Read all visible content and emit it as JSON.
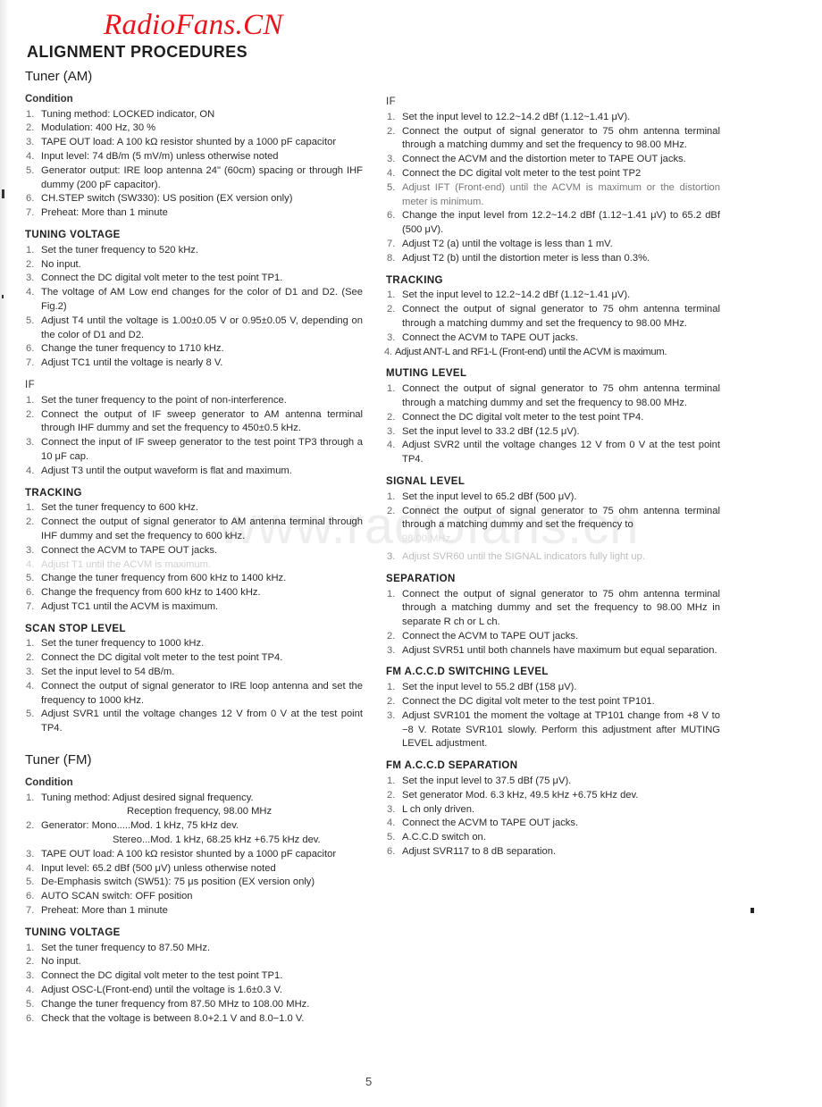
{
  "header": {
    "logo": "RadioFans.CN",
    "title": "ALIGNMENT PROCEDURES",
    "watermark": "www.radiofans.cn",
    "logo_color": "#e8141c"
  },
  "tuner_am": {
    "title": "Tuner (AM)",
    "condition": {
      "title": "Condition",
      "items": [
        "Tuning method: LOCKED indicator, ON",
        "Modulation: 400 Hz, 30 %",
        "TAPE OUT load: A 100 kΩ resistor shunted by a 1000 pF capacitor",
        "Input level: 74 dB/m (5 mV/m) unless otherwise noted",
        "Generator output: IRE loop antenna 24\" (60cm) spacing or through IHF dummy (200 pF capacitor).",
        "CH.STEP switch (SW330): US position (EX version only)",
        "Preheat: More than 1 minute"
      ]
    },
    "tuning_voltage": {
      "title": "TUNING VOLTAGE",
      "items": [
        "Set the tuner frequency to 520 kHz.",
        "No input.",
        "Connect the DC digital volt meter to the test point TP1.",
        "The voltage of AM Low end changes for the color of D1 and D2. (See Fig.2)",
        "Adjust T4 until the voltage is 1.00±0.05 V or 0.95±0.05 V, depending on the color of D1 and D2.",
        "Change the tuner frequency to 1710 kHz.",
        "Adjust TC1 until the voltage is nearly 8 V."
      ]
    },
    "if": {
      "title": "IF",
      "items": [
        "Set the tuner frequency to the point of non-interference.",
        "Connect the output of IF sweep generator to AM antenna terminal through IHF dummy and set the frequency to 450±0.5 kHz.",
        "Connect the input of IF sweep generator to the test point TP3 through a 10 μF cap.",
        "Adjust T3 until the output waveform is flat and maximum."
      ]
    },
    "tracking": {
      "title": "TRACKING",
      "items": [
        "Set the tuner frequency to 600 kHz.",
        "Connect the output of signal generator to AM antenna terminal through IHF dummy and set the frequency to 600 kHz.",
        "Connect the ACVM to TAPE OUT jacks.",
        "Adjust T1 until the ACVM is maximum.",
        "Change the tuner frequency from 600 kHz to 1400 kHz.",
        "Change the frequency from 600 kHz to 1400 kHz.",
        "Adjust TC1 until the ACVM is maximum."
      ]
    },
    "scan_stop_level": {
      "title": "SCAN STOP LEVEL",
      "items": [
        "Set the tuner frequency to 1000 kHz.",
        "Connect the DC digital volt meter to the test point TP4.",
        "Set the input level to 54 dB/m.",
        "Connect the output of signal generator to IRE loop antenna and set the frequency to 1000 kHz.",
        "Adjust SVR1 until the voltage changes 12 V from 0 V at the test point TP4."
      ]
    }
  },
  "tuner_fm": {
    "title": "Tuner (FM)",
    "condition": {
      "title": "Condition",
      "item1_a": "Tuning method: Adjust desired signal frequency.",
      "item1_b": "Reception frequency, 98.00 MHz",
      "item2_a": "Generator: Mono.....Mod. 1 kHz, 75 kHz dev.",
      "item2_b": "Stereo...Mod. 1 kHz, 68.25 kHz +6.75 kHz dev.",
      "items_rest": [
        "TAPE OUT load: A 100 kΩ resistor shunted by a 1000 pF capacitor",
        "Input level: 65.2 dBf (500 μV) unless otherwise noted",
        "De-Emphasis switch (SW51): 75 μs position (EX version only)",
        "AUTO SCAN switch: OFF position",
        "Preheat: More than 1 minute"
      ]
    },
    "tuning_voltage": {
      "title": "TUNING VOLTAGE",
      "items": [
        "Set the tuner frequency to 87.50 MHz.",
        "No input.",
        "Connect the DC digital volt meter to the test point TP1.",
        "Adjust OSC-L(Front-end) until the voltage is 1.6±0.3 V.",
        "Change the tuner frequency from 87.50 MHz to 108.00 MHz.",
        "Check that the voltage is between 8.0+2.1 V and 8.0−1.0 V."
      ]
    },
    "if": {
      "title": "IF",
      "items": [
        "Set the input level to 12.2~14.2 dBf (1.12~1.41 μV).",
        "Connect the output of signal generator to 75 ohm antenna terminal through a matching dummy and set the frequency to 98.00 MHz.",
        "Connect the ACVM and the distortion meter to TAPE OUT jacks.",
        "Connect the DC digital volt meter to the test point TP2",
        "Adjust IFT (Front-end) until the ACVM is maximum or the distortion meter is minimum.",
        "Change the input level from 12.2~14.2 dBf (1.12~1.41 μV) to 65.2 dBf (500 μV).",
        "Adjust T2 (a) until the voltage is less than 1 mV.",
        "Adjust T2 (b) until the distortion meter is less than 0.3%."
      ]
    },
    "tracking": {
      "title": "TRACKING",
      "items": [
        "Set the input level to 12.2~14.2 dBf (1.12~1.41 μV).",
        "Connect the output of signal generator to 75 ohm antenna terminal through a matching dummy and set the frequency to 98.00 MHz.",
        "Connect the ACVM to TAPE OUT jacks.",
        "Adjust ANT-L and RF1-L (Front-end) until the ACVM is maximum."
      ]
    },
    "muting_level": {
      "title": "MUTING LEVEL",
      "items": [
        "Connect the output of signal generator to 75 ohm antenna terminal through a matching dummy and set the frequency to 98.00 MHz.",
        "Connect the DC digital volt meter to the test point TP4.",
        "Set the input level to 33.2 dBf (12.5 μV).",
        "Adjust SVR2 until the voltage changes 12 V from 0 V at the test point TP4."
      ]
    },
    "signal_level": {
      "title": "SIGNAL LEVEL",
      "items": [
        "Set the input level to 65.2 dBf (500 μV).",
        "Connect the output of signal generator to 75 ohm antenna terminal through a matching dummy and set the frequency to",
        "Adjust SVR60 until the SIGNAL indicators fully light up."
      ],
      "item2_faded_tail": "98.00 MHz."
    },
    "separation": {
      "title": "SEPARATION",
      "items": [
        "Connect the output of signal generator to 75 ohm antenna terminal through a matching dummy and set the frequency to 98.00 MHz in separate R ch or L ch.",
        "Connect the ACVM to TAPE OUT jacks.",
        "Adjust SVR51 until both channels have maximum but equal separation."
      ]
    },
    "accd_switching_level": {
      "title": "FM A.C.C.D SWITCHING LEVEL",
      "items": [
        "Set the input level to 55.2 dBf (158 μV).",
        "Connect the DC digital volt meter to the test point TP101.",
        "Adjust SVR101 the moment the voltage at TP101 change from +8 V to −8 V. Rotate SVR101 slowly. Perform this adjustment after MUTING LEVEL adjustment."
      ]
    },
    "accd_separation": {
      "title": "FM A.C.C.D SEPARATION",
      "items": [
        "Set the input level to 37.5 dBf (75 μV).",
        "Set generator Mod. 6.3 kHz, 49.5 kHz +6.75 kHz dev.",
        "L ch only driven.",
        "Connect the ACVM to TAPE OUT jacks.",
        "A.C.C.D switch on.",
        "Adjust SVR117 to 8 dB separation."
      ]
    }
  },
  "numbers": [
    "1.",
    "2.",
    "3.",
    "4.",
    "5.",
    "6.",
    "7.",
    "8."
  ],
  "page_number": "5"
}
